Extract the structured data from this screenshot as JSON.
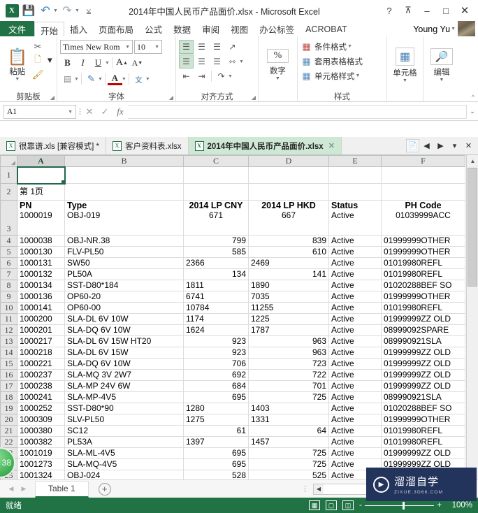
{
  "window": {
    "title": "2014年中国人民币产品面价.xlsx - Microsoft Excel",
    "help_icon": "?",
    "ribbon_display_icon": "ribbon-display-options",
    "minimize_icon": "–",
    "restore_icon": "❐",
    "close_icon": "✕"
  },
  "quick_access": {
    "app_logo": "X",
    "save_icon": "save-icon",
    "undo_icon": "↰",
    "redo_icon": "↱",
    "customize_icon": "⩣"
  },
  "ribbon_tabs": {
    "file": "文件",
    "items": [
      {
        "label": "开始",
        "active": true
      },
      {
        "label": "插入",
        "active": false
      },
      {
        "label": "页面布局",
        "active": false
      },
      {
        "label": "公式",
        "active": false
      },
      {
        "label": "数据",
        "active": false
      },
      {
        "label": "审阅",
        "active": false
      },
      {
        "label": "视图",
        "active": false
      },
      {
        "label": "办公标签",
        "active": false
      },
      {
        "label": "ACROBAT",
        "active": false
      }
    ],
    "user": "Young Yu"
  },
  "ribbon": {
    "clipboard": {
      "label": "剪贴板",
      "paste": "粘贴",
      "cut_icon": "scissors-icon",
      "copy_icon": "copy-icon",
      "format_painter_icon": "format-painter-icon"
    },
    "font": {
      "label": "字体",
      "font_name": "Times New Rom",
      "font_size": "10",
      "bold": "B",
      "italic": "I",
      "underline": "U",
      "grow_font": "A",
      "shrink_font": "A",
      "border_icon": "borders-icon",
      "fill_icon": "fill-color-icon",
      "font_color_icon": "font-color-icon",
      "phonetic": "文"
    },
    "alignment": {
      "label": "对齐方式",
      "top_align_icon": "align-top-icon",
      "middle_align_icon": "align-middle-icon",
      "bottom_align_icon": "align-bottom-icon",
      "orientation_icon": "orientation-icon",
      "wrap_text_icon": "wrap-text-icon",
      "merge_icon": "merge-cells-icon",
      "decrease_indent_icon": "decrease-indent-icon",
      "increase_indent_icon": "increase-indent-icon"
    },
    "number": {
      "label": "数字",
      "percent": "%"
    },
    "styles": {
      "label": "样式",
      "conditional": "条件格式",
      "table_format": "套用表格格式",
      "cell_styles": "单元格样式"
    },
    "cells": {
      "label": "单元格",
      "icon": "insert-cells-icon"
    },
    "editing": {
      "label": "编辑",
      "icon": "find-select-icon"
    },
    "collapse_icon": "^"
  },
  "formula_bar": {
    "name_box": "A1",
    "cancel_icon": "✕",
    "enter_icon": "✓",
    "fx_icon": "fx",
    "value": "",
    "expand_icon": "⌄"
  },
  "doc_tabs": {
    "items": [
      {
        "label": "很靠谱.xls  [兼容模式] *",
        "active": false
      },
      {
        "label": "客户资料表.xlsx",
        "active": false
      },
      {
        "label": "2014年中国人民币产品面价.xlsx",
        "active": true
      }
    ],
    "new_tab_icon": "new-document-icon",
    "prev_icon": "◀",
    "next_icon": "▶",
    "list_icon": "▾",
    "close_icon": "✕"
  },
  "grid": {
    "columns": [
      "A",
      "B",
      "C",
      "D",
      "E",
      "F"
    ],
    "selected_column": "A",
    "selected_cell": "A1",
    "row2_label": "第 1页",
    "headers": [
      "PN",
      "Type",
      "2014 LP CNY",
      "2014 LP HKD",
      "Status",
      "PH Code"
    ],
    "header_row_first_data": {
      "pn": "1000019",
      "type": "OBJ-019",
      "cny": "671",
      "hkd": "667",
      "status": "Active",
      "ph": "01039999ACC"
    },
    "rows": [
      {
        "n": "4",
        "pn": "1000038",
        "type": "OBJ-NR.38",
        "cny": "799",
        "hkd": "839",
        "cal": "r",
        "status": "Active",
        "ph": "01999999OTHER"
      },
      {
        "n": "5",
        "pn": "1000130",
        "type": "FLV-PL50",
        "cny": "585",
        "hkd": "610",
        "cal": "r",
        "status": "Active",
        "ph": "01999999OTHER"
      },
      {
        "n": "6",
        "pn": "1000131",
        "type": "SW50",
        "cny": "2366",
        "hkd": "2469",
        "cal": "l",
        "status": "Active",
        "ph": "01019980REFL"
      },
      {
        "n": "7",
        "pn": "1000132",
        "type": "PL50A",
        "cny": "134",
        "hkd": "141",
        "cal": "r",
        "status": "Active",
        "ph": "01019980REFL"
      },
      {
        "n": "8",
        "pn": "1000134",
        "type": "SST-D80*184",
        "cny": "1811",
        "hkd": "1890",
        "cal": "l",
        "status": "Active",
        "ph": "01020288BEF  SO"
      },
      {
        "n": "9",
        "pn": "1000136",
        "type": "OP60-20",
        "cny": "6741",
        "hkd": "7035",
        "cal": "l",
        "status": "Active",
        "ph": "01999999OTHER"
      },
      {
        "n": "10",
        "pn": "1000141",
        "type": "OP60-00",
        "cny": "10784",
        "hkd": "11255",
        "cal": "l",
        "status": "Active",
        "ph": "01019980REFL"
      },
      {
        "n": "11",
        "pn": "1000200",
        "type": "SLA-DL 6V 10W",
        "cny": "1174",
        "hkd": "1225",
        "cal": "l",
        "status": "Active",
        "ph": "01999999ZZ  OLD"
      },
      {
        "n": "12",
        "pn": "1000201",
        "type": "SLA-DQ 6V 10W",
        "cny": "1624",
        "hkd": "1787",
        "cal": "l",
        "status": "Active",
        "ph": "08999092SPARE"
      },
      {
        "n": "13",
        "pn": "1000217",
        "type": "SLA-DL 6V 15W HT20",
        "cny": "923",
        "hkd": "963",
        "cal": "r",
        "status": "Active",
        "ph": "089990921SLA"
      },
      {
        "n": "14",
        "pn": "1000218",
        "type": "SLA-DL 6V 15W",
        "cny": "923",
        "hkd": "963",
        "cal": "r",
        "status": "Active",
        "ph": "01999999ZZ  OLD"
      },
      {
        "n": "15",
        "pn": "1000221",
        "type": "SLA-DQ 6V 10W",
        "cny": "706",
        "hkd": "723",
        "cal": "r",
        "status": "Active",
        "ph": "01999999ZZ  OLD"
      },
      {
        "n": "16",
        "pn": "1000237",
        "type": "SLA-MQ 3V 2W7",
        "cny": "692",
        "hkd": "722",
        "cal": "r",
        "status": "Active",
        "ph": "01999999ZZ  OLD"
      },
      {
        "n": "17",
        "pn": "1000238",
        "type": "SLA-MP 24V 6W",
        "cny": "684",
        "hkd": "701",
        "cal": "r",
        "status": "Active",
        "ph": "01999999ZZ  OLD"
      },
      {
        "n": "18",
        "pn": "1000241",
        "type": "SLA-MP-4V5",
        "cny": "695",
        "hkd": "725",
        "cal": "r",
        "status": "Active",
        "ph": "089990921SLA"
      },
      {
        "n": "19",
        "pn": "1000252",
        "type": "SST-D80*90",
        "cny": "1280",
        "hkd": "1403",
        "cal": "l",
        "status": "Active",
        "ph": "01020288BEF  SO"
      },
      {
        "n": "20",
        "pn": "1000309",
        "type": "SLV-PL50",
        "cny": "1275",
        "hkd": "1331",
        "cal": "l",
        "status": "Active",
        "ph": "01999999OTHER"
      },
      {
        "n": "21",
        "pn": "1000380",
        "type": "SC12",
        "cny": "61",
        "hkd": "64",
        "cal": "r",
        "status": "Active",
        "ph": "01019980REFL"
      },
      {
        "n": "22",
        "pn": "1000382",
        "type": "PL53A",
        "cny": "1397",
        "hkd": "1457",
        "cal": "l",
        "status": "Active",
        "ph": "01019980REFL"
      },
      {
        "n": "23",
        "pn": "1001019",
        "type": "SLA-ML-4V5",
        "cny": "695",
        "hkd": "725",
        "cal": "r",
        "status": "Active",
        "ph": "01999999ZZ  OLD"
      },
      {
        "n": "24",
        "pn": "1001273",
        "type": "SLA-MQ-4V5",
        "cny": "695",
        "hkd": "725",
        "cal": "r",
        "status": "Active",
        "ph": "01999999ZZ  OLD"
      },
      {
        "n": "25",
        "pn": "1001324",
        "type": "OBJ-024",
        "cny": "528",
        "hkd": "525",
        "cal": "r",
        "status": "Active",
        "ph": ""
      }
    ]
  },
  "sheet_bar": {
    "prev_icon": "◀",
    "next_icon": "▶",
    "sheet_name": "Table 1",
    "add_sheet_icon": "+"
  },
  "status_bar": {
    "state": "就绪",
    "normal_view_icon": "normal-view-icon",
    "page_layout_icon": "page-layout-icon",
    "page_break_icon": "page-break-view-icon",
    "zoom_out": "-",
    "zoom_in": "+",
    "zoom_level": "100%"
  },
  "overlays": {
    "watermark_title": "溜溜自学",
    "watermark_url": "ZIXUE.3D66.COM",
    "badge_text": "38"
  },
  "colors": {
    "accent_green": "#217346",
    "tab_active_bg": "#cfe8d6",
    "selection": "#21684a"
  }
}
